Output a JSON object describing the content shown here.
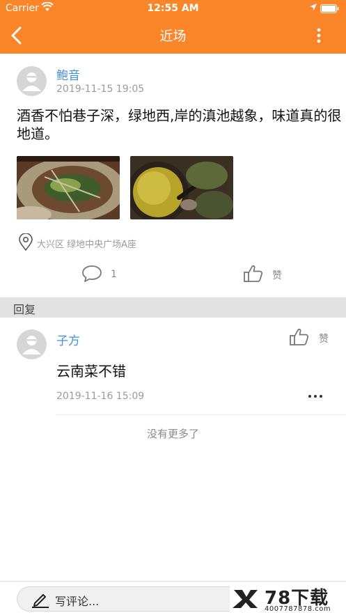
{
  "status_bar": {
    "carrier": "Carrier",
    "time": "12:55 AM"
  },
  "header": {
    "title": "近场"
  },
  "post": {
    "author": "鲍音",
    "time": "2019-11-15 19:05",
    "text": "酒香不怕巷子深，绿地西,岸的滇池越象，味道真的很地道。",
    "location": "大兴区 绿地中央广场A座",
    "comment_count": "1",
    "like_label": "赞"
  },
  "replies_section": {
    "title": "回复"
  },
  "reply": {
    "author": "子方",
    "like_label": "赞",
    "text": "云南菜不错",
    "time": "2019-11-16 15:09"
  },
  "no_more_text": "没有更多了",
  "bottom_bar": {
    "placeholder": "写评论..."
  },
  "watermark": {
    "title": "78下载",
    "subtitle": "4007787878.com"
  },
  "colors": {
    "accent": "#fb862a",
    "link": "#3f8fd9",
    "muted": "#9b9b9b"
  }
}
